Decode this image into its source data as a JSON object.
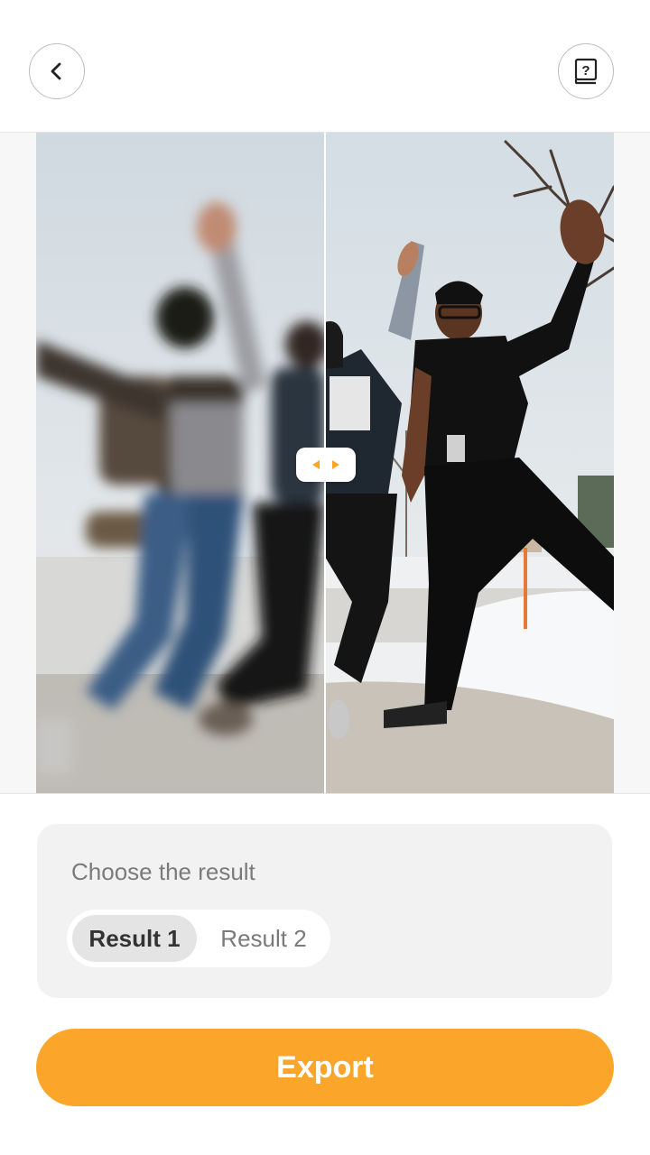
{
  "colors": {
    "accent": "#fba62b",
    "panel_bg": "#f2f2f2",
    "muted_text": "#7b7b7b"
  },
  "header": {
    "back_icon": "chevron-left-icon",
    "help_icon": "book-question-icon"
  },
  "compare": {
    "left_label": "before (blurred)",
    "right_label": "after (enhanced)",
    "handle_icon": "left-right-arrows-icon"
  },
  "result_panel": {
    "title": "Choose the result",
    "options": [
      "Result 1",
      "Result 2"
    ],
    "selected": "Result 1"
  },
  "export_label": "Export"
}
